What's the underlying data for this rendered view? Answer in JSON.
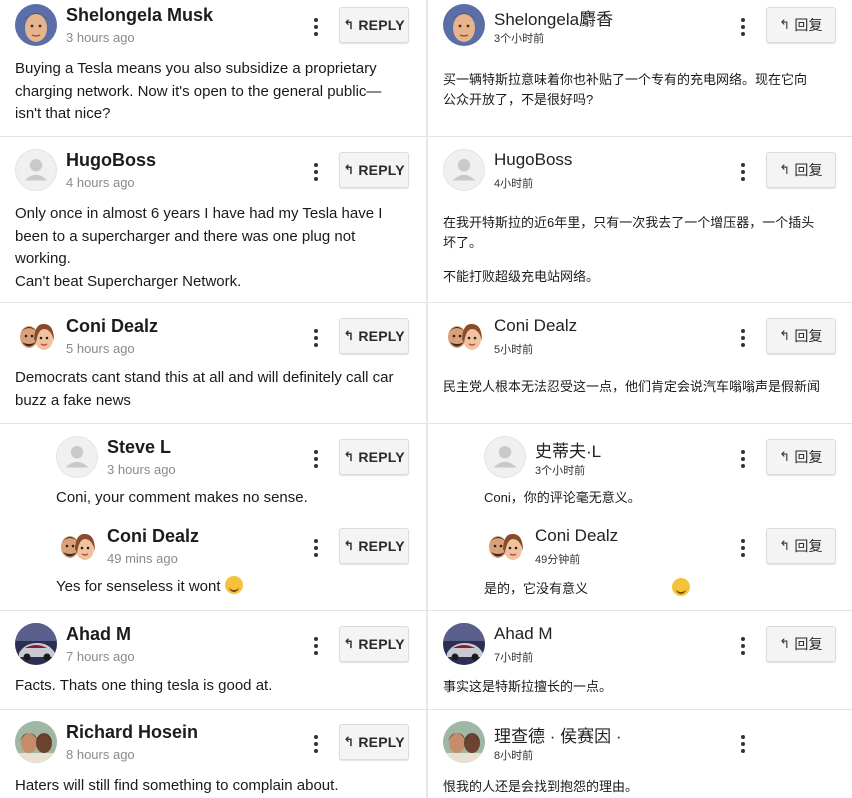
{
  "left": {
    "reply_label": "REPLY",
    "comments": [
      {
        "author": "Shelongela Musk",
        "time": "3 hours ago",
        "lines": [
          "Buying a Tesla means you also subsidize a proprietary",
          "charging network. Now it's open to the general public—",
          "isn't that nice?"
        ]
      },
      {
        "author": "HugoBoss",
        "time": "4 hours ago",
        "lines": [
          "Only once in almost 6 years I have had my Tesla have I",
          "been to a supercharger and there was one plug not",
          "working.",
          "Can't beat Supercharger Network."
        ]
      },
      {
        "author": "Coni Dealz",
        "time": "5 hours ago",
        "lines": [
          "Democrats cant stand this at all and will definitely call car",
          "buzz a fake news"
        ]
      },
      {
        "author": "Steve L",
        "time": "3 hours ago",
        "lines": [
          "Coni, your comment makes no sense."
        ]
      },
      {
        "author": "Coni Dealz",
        "time": "49 mins ago",
        "lines": [
          "Yes for senseless it wont"
        ]
      },
      {
        "author": "Ahad M",
        "time": "7 hours ago",
        "lines": [
          "Facts. Thats one thing tesla is good at."
        ]
      },
      {
        "author": "Richard Hosein",
        "time": "8 hours ago",
        "lines": [
          "Haters will still find something to complain about."
        ]
      }
    ]
  },
  "right": {
    "reply_label": "回复",
    "comments": [
      {
        "author": "Shelongela麝香",
        "time": "3个小时前",
        "lines": [
          "买一辆特斯拉意味着你也补贴了一个专有的充电网络。现在它向",
          "公众开放了，不是很好吗?"
        ]
      },
      {
        "author": "HugoBoss",
        "time": "4小时前",
        "lines": [
          "在我开特斯拉的近6年里，只有一次我去了一个增压器，一个插头",
          "坏了。",
          "",
          "不能打败超级充电站网络。"
        ]
      },
      {
        "author": "Coni Dealz",
        "time": "5小时前",
        "lines": [
          "民主党人根本无法忍受这一点，他们肯定会说汽车嗡嗡声是假新闻"
        ]
      },
      {
        "author": "史蒂夫·L",
        "time": "3个小时前",
        "lines": [
          "Coni，你的评论毫无意义。"
        ]
      },
      {
        "author": "Coni Dealz",
        "time": "49分钟前",
        "lines": [
          "是的，它没有意义"
        ]
      },
      {
        "author": "Ahad M",
        "time": "7小时前",
        "lines": [
          "事实这是特斯拉擅长的一点。"
        ]
      },
      {
        "author": "理查德 · 侯赛因 ·",
        "time": "8小时前",
        "lines": [
          "恨我的人还是会找到抱怨的理由。"
        ]
      }
    ]
  }
}
